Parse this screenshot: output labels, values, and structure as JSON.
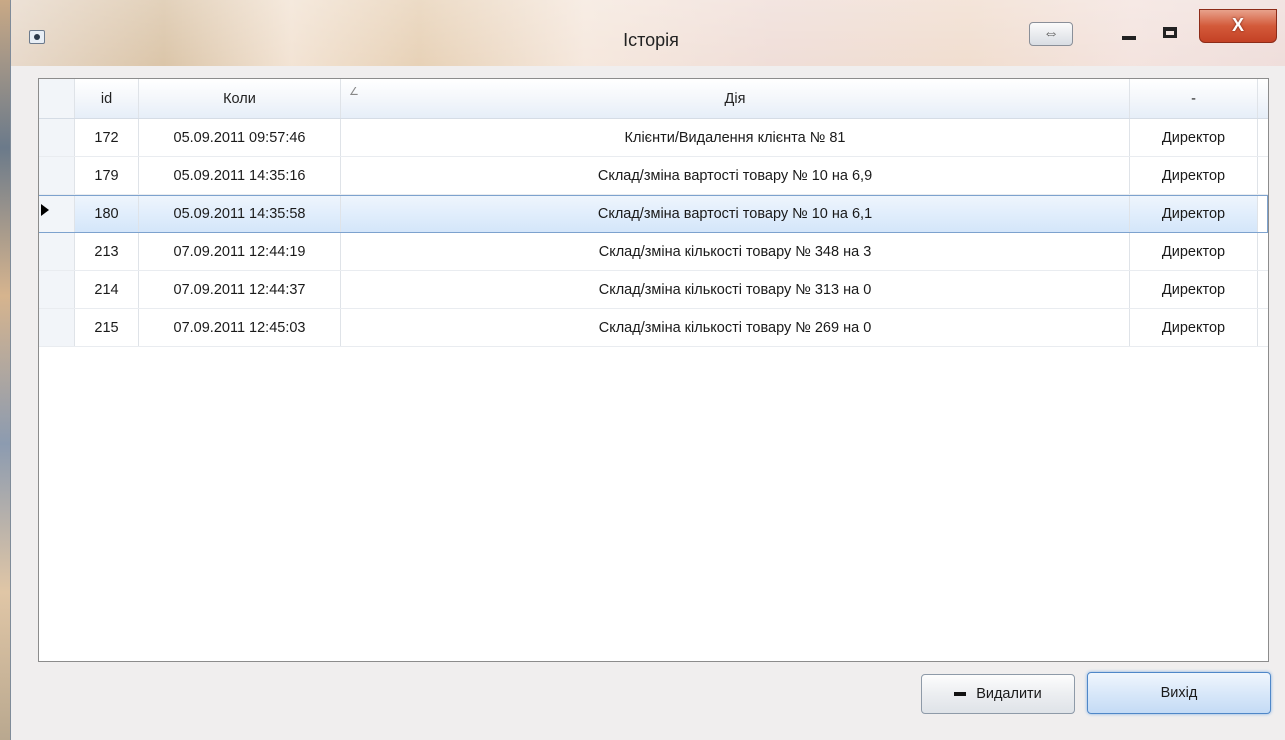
{
  "window": {
    "title": "Історія",
    "swap_glyph": "⇔",
    "close_glyph": "X"
  },
  "grid": {
    "columns": [
      {
        "key": "id",
        "label": "id"
      },
      {
        "key": "when",
        "label": "Коли"
      },
      {
        "key": "action",
        "label": "Дія"
      },
      {
        "key": "user",
        "label": "-"
      }
    ],
    "sort_glyph": "∠",
    "selected_index": 2,
    "rows": [
      {
        "id": "172",
        "when": "05.09.2011 09:57:46",
        "action": "Клієнти/Видалення клієнта № 81",
        "user": "Директор"
      },
      {
        "id": "179",
        "when": "05.09.2011 14:35:16",
        "action": "Склад/зміна вартості товару № 10 на 6,9",
        "user": "Директор"
      },
      {
        "id": "180",
        "when": "05.09.2011 14:35:58",
        "action": "Склад/зміна вартості товару № 10 на 6,1",
        "user": "Директор"
      },
      {
        "id": "213",
        "when": "07.09.2011 12:44:19",
        "action": "Склад/зміна кількості товару № 348 на 3",
        "user": "Директор"
      },
      {
        "id": "214",
        "when": "07.09.2011 12:44:37",
        "action": "Склад/зміна кількості товару № 313 на 0",
        "user": "Директор"
      },
      {
        "id": "215",
        "when": "07.09.2011 12:45:03",
        "action": "Склад/зміна кількості товару № 269 на 0",
        "user": "Директор"
      }
    ]
  },
  "buttons": {
    "delete_label": "Видалити",
    "exit_label": "Вихід"
  }
}
